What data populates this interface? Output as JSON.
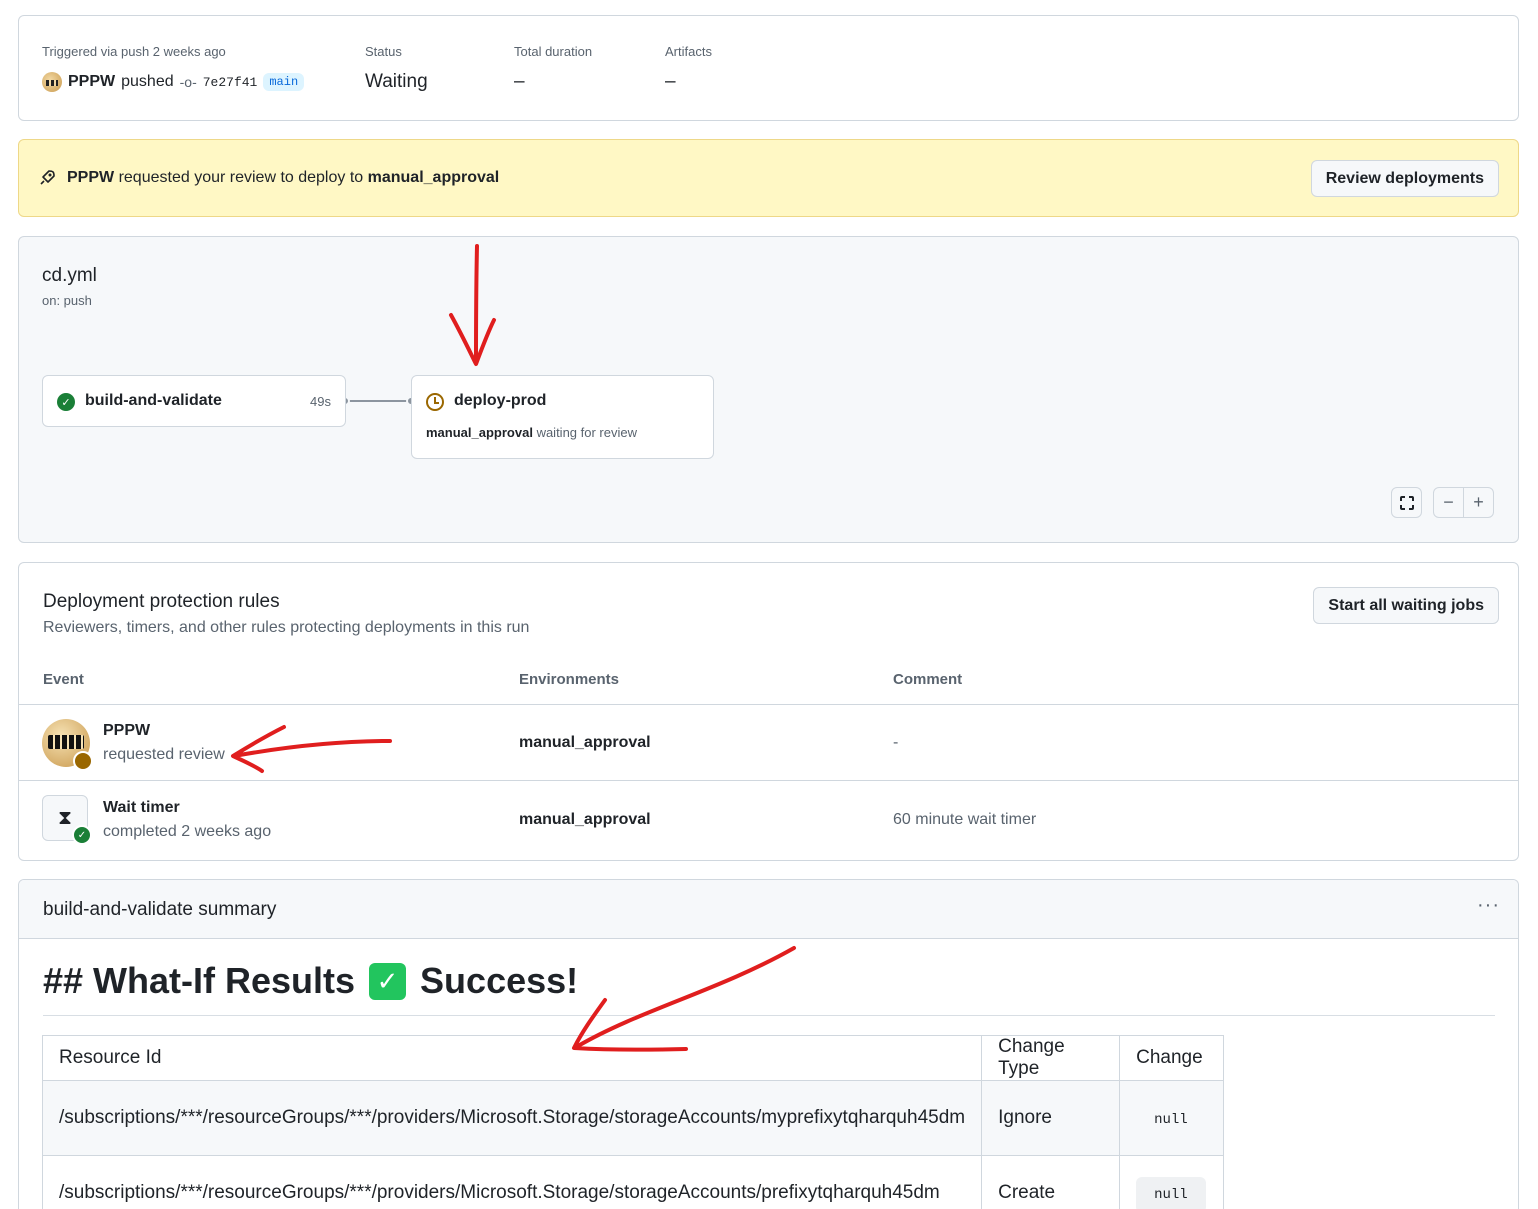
{
  "run": {
    "trigger_label": "Triggered via push 2 weeks ago",
    "actor": "PPPW",
    "action": "pushed",
    "commit_sha": "7e27f41",
    "branch": "main",
    "status_label": "Status",
    "status_value": "Waiting",
    "duration_label": "Total duration",
    "duration_value": "–",
    "artifacts_label": "Artifacts",
    "artifacts_value": "–"
  },
  "banner": {
    "actor": "PPPW",
    "text": "requested your review to deploy to",
    "environment": "manual_approval",
    "button_label": "Review deployments"
  },
  "workflow": {
    "file": "cd.yml",
    "trigger": "on: push",
    "jobs": [
      {
        "name": "build-and-validate",
        "status": "success",
        "duration": "49s"
      },
      {
        "name": "deploy-prod",
        "status": "waiting",
        "env": "manual_approval",
        "note": "waiting for review"
      }
    ],
    "controls": {
      "fullscreen_icon": "fullscreen-icon",
      "zoom_out": "−",
      "zoom_in": "+"
    }
  },
  "protection": {
    "title": "Deployment protection rules",
    "subtitle": "Reviewers, timers, and other rules protecting deployments in this run",
    "button_label": "Start all waiting jobs",
    "columns": [
      "Event",
      "Environments",
      "Comment"
    ],
    "rows": [
      {
        "name": "PPPW",
        "sub": "requested review",
        "environment": "manual_approval",
        "comment": "-"
      },
      {
        "name": "Wait timer",
        "sub": "completed 2 weeks ago",
        "environment": "manual_approval",
        "comment": "60 minute wait timer"
      }
    ]
  },
  "summary": {
    "title": "build-and-validate summary",
    "menu_label": "···",
    "heading_prefix": "## What-If Results",
    "heading_emoji": "✓",
    "heading_suffix": "Success!",
    "table": {
      "columns": [
        "Resource Id",
        "Change Type",
        "Change"
      ],
      "rows": [
        {
          "resource": "/subscriptions/***/resourceGroups/***/providers/Microsoft.Storage/storageAccounts/myprefixytqharquh45dm",
          "change_type": "Ignore",
          "change": "null"
        },
        {
          "resource": "/subscriptions/***/resourceGroups/***/providers/Microsoft.Storage/storageAccounts/prefixytqharquh45dm",
          "change_type": "Create",
          "change": "null"
        }
      ]
    }
  },
  "colors": {
    "success": "#1a7f37",
    "waiting": "#9a6700",
    "banner_bg": "#fff8c5",
    "annotation": "#e01e1e"
  }
}
